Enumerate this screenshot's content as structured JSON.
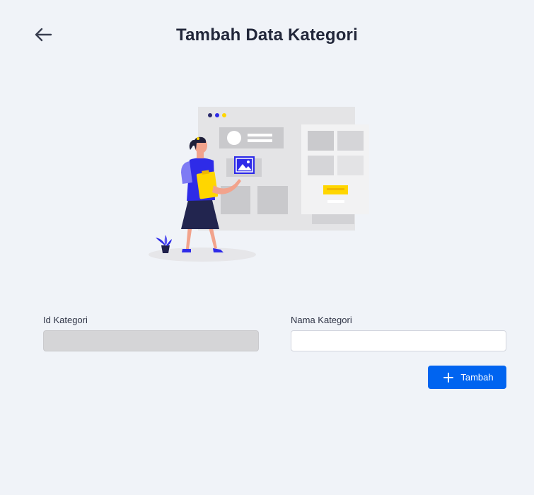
{
  "header": {
    "title": "Tambah Data Kategori",
    "back_icon": "arrow-left-icon"
  },
  "illustration": {
    "name": "data-entry-illustration"
  },
  "form": {
    "id_kategori": {
      "label": "Id Kategori",
      "value": "",
      "disabled": true
    },
    "nama_kategori": {
      "label": "Nama Kategori",
      "value": "",
      "placeholder": ""
    },
    "submit": {
      "label": "Tambah",
      "icon": "plus-icon"
    }
  },
  "colors": {
    "background": "#F0F3F8",
    "primary": "#0064F0",
    "accent_illustration": "#2E2BE8",
    "yellow": "#FFD600",
    "disabled_input": "#D5D5D7"
  }
}
